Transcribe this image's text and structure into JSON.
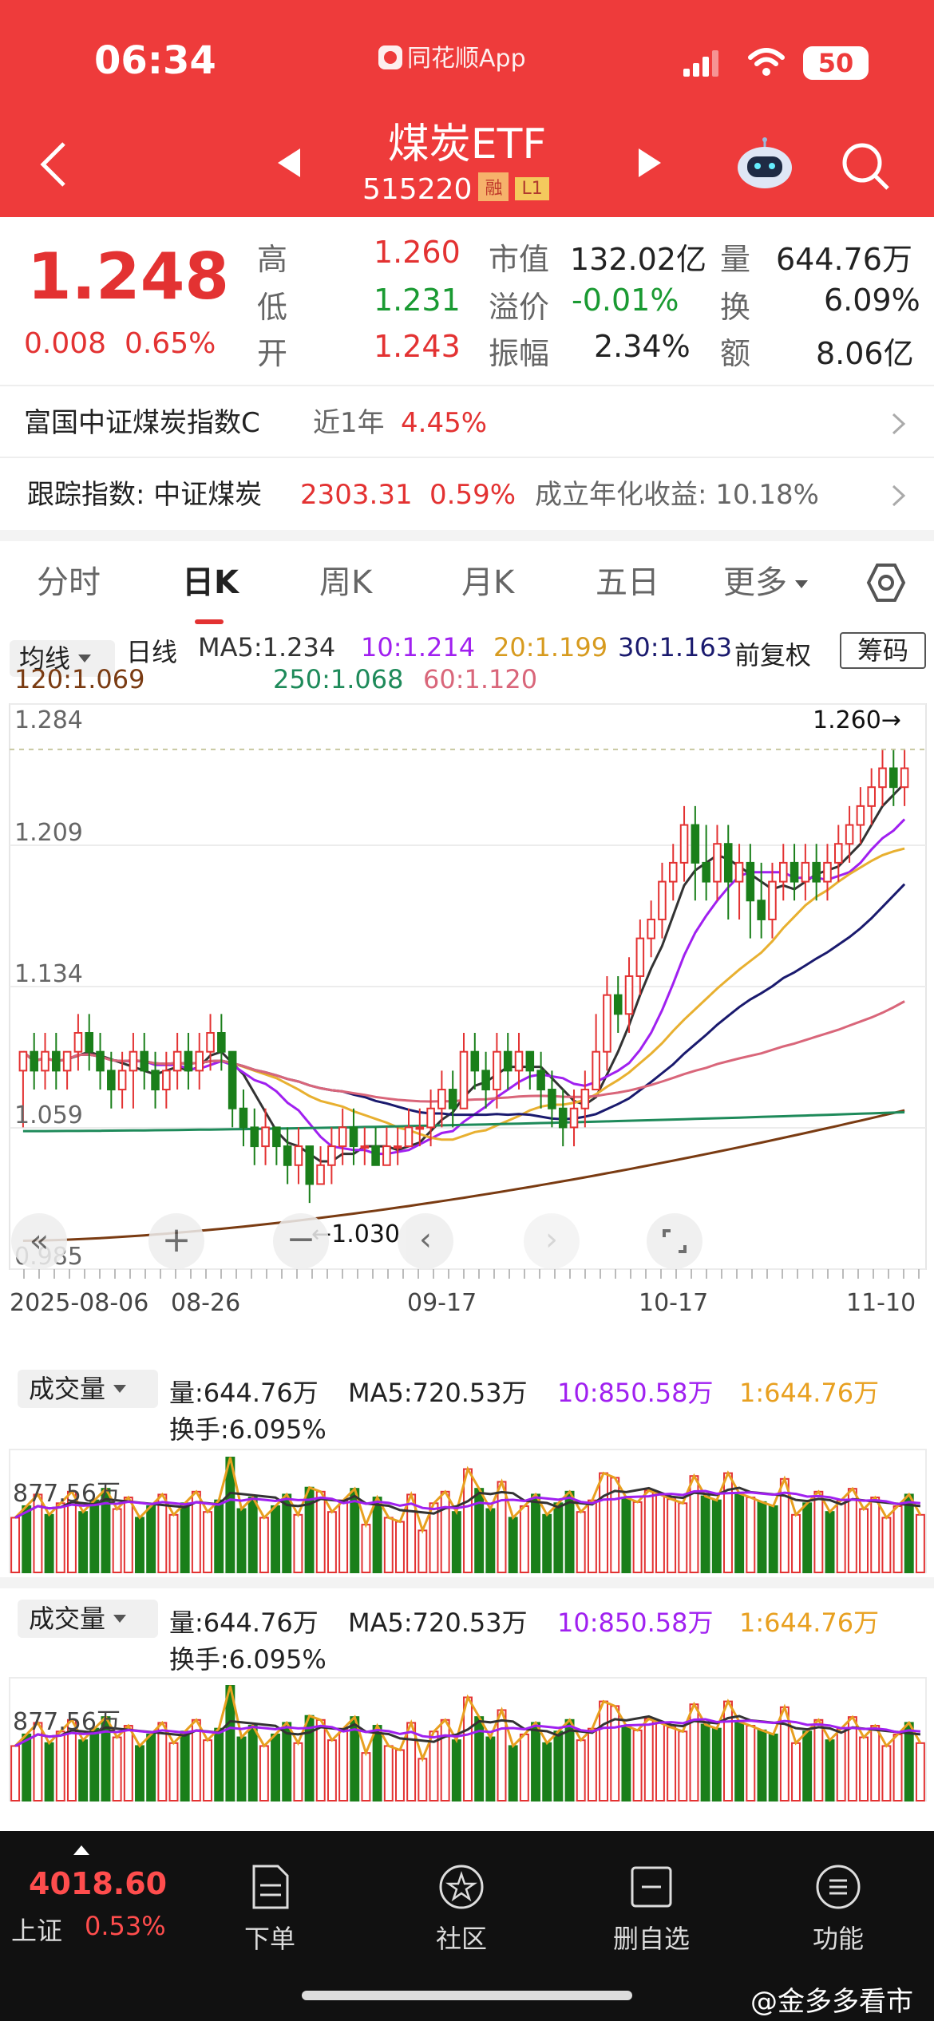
{
  "status": {
    "time": "06:34",
    "app_name": "同花顺App",
    "battery": "50"
  },
  "header": {
    "title": "煤炭ETF",
    "code": "515220",
    "tag_margin": "融",
    "tag_level": "L1"
  },
  "quote": {
    "price": "1.248",
    "change": "0.008",
    "change_pct": "0.65%",
    "high_label": "高",
    "high": "1.260",
    "low_label": "低",
    "low": "1.231",
    "open_label": "开",
    "open": "1.243",
    "mktcap_label": "市值",
    "mktcap": "132.02亿",
    "premium_label": "溢价",
    "premium": "-0.01%",
    "amp_label": "振幅",
    "amp": "2.34%",
    "vol_label": "量",
    "vol": "644.76万",
    "turnover_label": "换",
    "turnover": "6.09%",
    "amount_label": "额",
    "amount": "8.06亿"
  },
  "fund_row": {
    "name": "富国中证煤炭指数C",
    "period": "近1年",
    "ret": "4.45%"
  },
  "track_row": {
    "label": "跟踪指数: 中证煤炭",
    "value": "2303.31",
    "pct": "0.59%",
    "annual": "成立年化收益: 10.18%"
  },
  "tabs": [
    "分时",
    "日K",
    "周K",
    "月K",
    "五日",
    "更多"
  ],
  "ma": {
    "selector": "均线",
    "kind": "日线",
    "ma5": "MA5:1.234",
    "ma10": "10:1.214",
    "ma20": "20:1.199",
    "ma30": "30:1.163",
    "adj": "前复权",
    "chip": "筹码",
    "ma120": "120:1.069",
    "ma250": "250:1.068",
    "ma60": "60:1.120"
  },
  "colors": {
    "up": "#e33232",
    "down": "#1a7f1a",
    "ma5": "#333333",
    "ma10": "#a020f0",
    "ma20": "#e8b030",
    "ma30": "#1a1a6e",
    "ma60": "#d9667a",
    "ma120": "#7a3b12",
    "ma250": "#1e8a5a"
  },
  "chart_data": {
    "type": "candlestick",
    "y_ticks": [
      "1.284",
      "1.209",
      "1.134",
      "1.059",
      "0.985"
    ],
    "x_ticks": [
      "2025-08-06",
      "08-26",
      "09-17",
      "10-17",
      "11-10"
    ],
    "high_annotation": "1.260→",
    "low_annotation": "←1.030",
    "ylim": [
      0.985,
      1.284
    ],
    "candles": [
      [
        1.09,
        1.1,
        1.1,
        1.06
      ],
      [
        1.1,
        1.09,
        1.11,
        1.08
      ],
      [
        1.09,
        1.1,
        1.11,
        1.08
      ],
      [
        1.1,
        1.09,
        1.11,
        1.08
      ],
      [
        1.09,
        1.1,
        1.1,
        1.08
      ],
      [
        1.1,
        1.11,
        1.12,
        1.09
      ],
      [
        1.11,
        1.1,
        1.12,
        1.09
      ],
      [
        1.1,
        1.09,
        1.11,
        1.08
      ],
      [
        1.09,
        1.08,
        1.1,
        1.07
      ],
      [
        1.08,
        1.09,
        1.1,
        1.07
      ],
      [
        1.09,
        1.1,
        1.11,
        1.07
      ],
      [
        1.1,
        1.09,
        1.11,
        1.08
      ],
      [
        1.09,
        1.08,
        1.1,
        1.07
      ],
      [
        1.08,
        1.09,
        1.1,
        1.07
      ],
      [
        1.09,
        1.1,
        1.11,
        1.08
      ],
      [
        1.1,
        1.09,
        1.11,
        1.08
      ],
      [
        1.09,
        1.1,
        1.11,
        1.08
      ],
      [
        1.1,
        1.11,
        1.12,
        1.09
      ],
      [
        1.11,
        1.1,
        1.12,
        1.09
      ],
      [
        1.1,
        1.07,
        1.1,
        1.06
      ],
      [
        1.07,
        1.06,
        1.08,
        1.05
      ],
      [
        1.06,
        1.05,
        1.07,
        1.04
      ],
      [
        1.05,
        1.06,
        1.07,
        1.04
      ],
      [
        1.06,
        1.05,
        1.06,
        1.04
      ],
      [
        1.05,
        1.04,
        1.06,
        1.03
      ],
      [
        1.04,
        1.05,
        1.06,
        1.03
      ],
      [
        1.05,
        1.03,
        1.05,
        1.02
      ],
      [
        1.03,
        1.04,
        1.05,
        1.03
      ],
      [
        1.04,
        1.05,
        1.06,
        1.03
      ],
      [
        1.05,
        1.06,
        1.07,
        1.04
      ],
      [
        1.06,
        1.05,
        1.07,
        1.04
      ],
      [
        1.05,
        1.05,
        1.06,
        1.04
      ],
      [
        1.05,
        1.04,
        1.06,
        1.04
      ],
      [
        1.04,
        1.05,
        1.06,
        1.04
      ],
      [
        1.05,
        1.05,
        1.06,
        1.04
      ],
      [
        1.05,
        1.06,
        1.07,
        1.05
      ],
      [
        1.06,
        1.06,
        1.07,
        1.05
      ],
      [
        1.06,
        1.07,
        1.08,
        1.05
      ],
      [
        1.07,
        1.08,
        1.09,
        1.06
      ],
      [
        1.08,
        1.07,
        1.09,
        1.06
      ],
      [
        1.07,
        1.1,
        1.11,
        1.07
      ],
      [
        1.1,
        1.09,
        1.11,
        1.08
      ],
      [
        1.09,
        1.08,
        1.1,
        1.07
      ],
      [
        1.08,
        1.1,
        1.11,
        1.07
      ],
      [
        1.1,
        1.09,
        1.11,
        1.08
      ],
      [
        1.09,
        1.1,
        1.11,
        1.08
      ],
      [
        1.1,
        1.09,
        1.1,
        1.08
      ],
      [
        1.09,
        1.08,
        1.1,
        1.07
      ],
      [
        1.08,
        1.07,
        1.09,
        1.06
      ],
      [
        1.07,
        1.06,
        1.08,
        1.05
      ],
      [
        1.06,
        1.07,
        1.08,
        1.05
      ],
      [
        1.07,
        1.08,
        1.09,
        1.06
      ],
      [
        1.08,
        1.1,
        1.12,
        1.08
      ],
      [
        1.1,
        1.13,
        1.14,
        1.09
      ],
      [
        1.13,
        1.12,
        1.14,
        1.11
      ],
      [
        1.12,
        1.14,
        1.15,
        1.11
      ],
      [
        1.14,
        1.16,
        1.17,
        1.13
      ],
      [
        1.16,
        1.17,
        1.18,
        1.15
      ],
      [
        1.17,
        1.19,
        1.2,
        1.16
      ],
      [
        1.19,
        1.2,
        1.21,
        1.18
      ],
      [
        1.2,
        1.22,
        1.23,
        1.19
      ],
      [
        1.22,
        1.2,
        1.23,
        1.18
      ],
      [
        1.2,
        1.19,
        1.22,
        1.18
      ],
      [
        1.19,
        1.21,
        1.22,
        1.18
      ],
      [
        1.21,
        1.19,
        1.22,
        1.17
      ],
      [
        1.19,
        1.2,
        1.21,
        1.17
      ],
      [
        1.2,
        1.18,
        1.21,
        1.16
      ],
      [
        1.18,
        1.17,
        1.2,
        1.16
      ],
      [
        1.17,
        1.19,
        1.2,
        1.16
      ],
      [
        1.19,
        1.2,
        1.21,
        1.18
      ],
      [
        1.2,
        1.19,
        1.21,
        1.18
      ],
      [
        1.19,
        1.2,
        1.21,
        1.18
      ],
      [
        1.2,
        1.19,
        1.21,
        1.18
      ],
      [
        1.19,
        1.2,
        1.21,
        1.18
      ],
      [
        1.2,
        1.21,
        1.22,
        1.19
      ],
      [
        1.21,
        1.22,
        1.23,
        1.2
      ],
      [
        1.22,
        1.23,
        1.24,
        1.21
      ],
      [
        1.23,
        1.24,
        1.25,
        1.22
      ],
      [
        1.24,
        1.25,
        1.26,
        1.23
      ],
      [
        1.25,
        1.24,
        1.26,
        1.23
      ],
      [
        1.24,
        1.25,
        1.26,
        1.23
      ]
    ],
    "volume_panels": [
      {
        "selector": "成交量",
        "vol": "量:644.76万",
        "ma5": "MA5:720.53万",
        "ma10": "10:850.58万",
        "ma1": "1:644.76万",
        "turnover": "换手:6.095%",
        "ref": "877.56万"
      },
      {
        "selector": "成交量",
        "vol": "量:644.76万",
        "ma5": "MA5:720.53万",
        "ma10": "10:850.58万",
        "ma1": "1:644.76万",
        "turnover": "换手:6.095%",
        "ref": "877.56万"
      }
    ]
  },
  "bottom_nav": {
    "index_price": "4018.60",
    "index_name": "上证",
    "index_pct": "0.53%",
    "items": [
      "下单",
      "社区",
      "删自选",
      "功能"
    ]
  },
  "watermark": "@金多多看市"
}
